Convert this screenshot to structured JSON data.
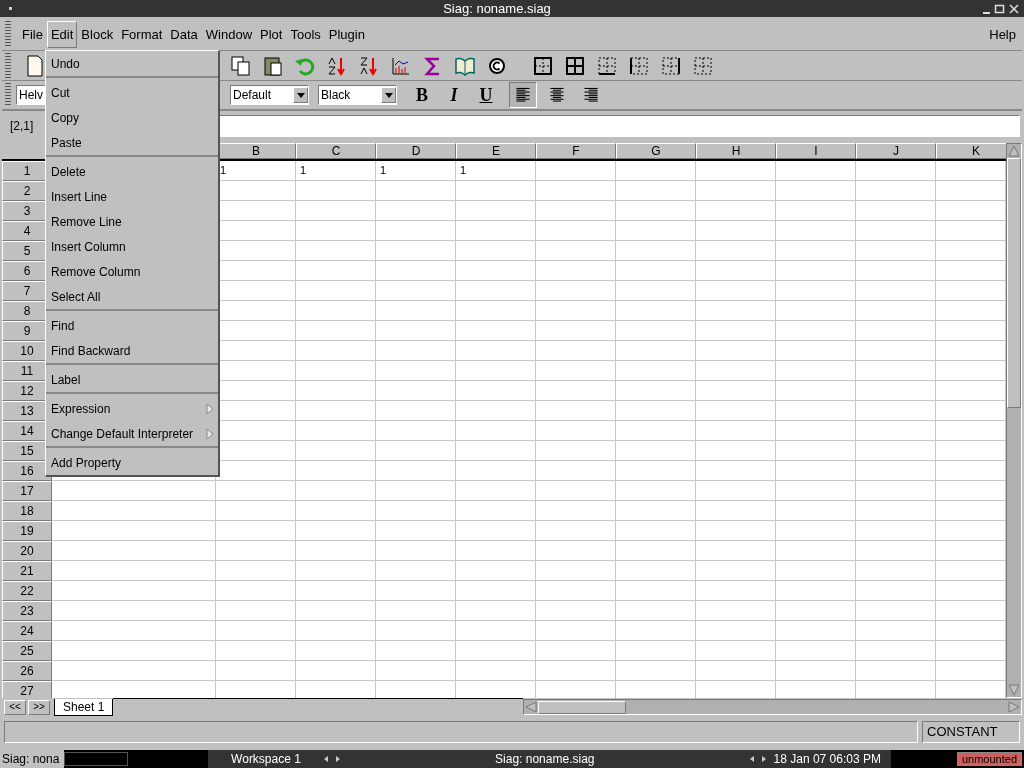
{
  "window": {
    "title": "Siag: noname.siag"
  },
  "menubar": {
    "items": [
      {
        "label": "File",
        "selected": false
      },
      {
        "label": "Edit",
        "selected": true
      },
      {
        "label": "Block",
        "selected": false
      },
      {
        "label": "Format",
        "selected": false
      },
      {
        "label": "Data",
        "selected": false
      },
      {
        "label": "Window",
        "selected": false
      },
      {
        "label": "Plot",
        "selected": false
      },
      {
        "label": "Tools",
        "selected": false
      },
      {
        "label": "Plugin",
        "selected": false
      }
    ],
    "help": "Help"
  },
  "format_bar": {
    "font": "Helv",
    "style": "Default",
    "text_color_name": "Black",
    "bold": "B",
    "italic": "I",
    "underline": "U",
    "alignments": [
      {
        "kind": "left",
        "selected": true
      },
      {
        "kind": "center",
        "selected": false
      },
      {
        "kind": "right",
        "selected": false
      }
    ]
  },
  "cell_ref": "[2,1]",
  "columns": [
    "B",
    "C",
    "D",
    "E",
    "F",
    "G",
    "H",
    "I",
    "J",
    "K"
  ],
  "rows": [
    {
      "label": "1",
      "values": [
        "1",
        "1",
        "1",
        "1"
      ]
    },
    {
      "label": "2"
    },
    {
      "label": "3"
    },
    {
      "label": "4"
    },
    {
      "label": "5"
    },
    {
      "label": "6"
    },
    {
      "label": "7"
    },
    {
      "label": "8"
    },
    {
      "label": "9"
    },
    {
      "label": "10"
    },
    {
      "label": "11"
    },
    {
      "label": "12"
    },
    {
      "label": "13"
    },
    {
      "label": "14"
    },
    {
      "label": "15"
    },
    {
      "label": "16"
    },
    {
      "label": "17"
    },
    {
      "label": "18"
    },
    {
      "label": "19"
    },
    {
      "label": "20"
    },
    {
      "label": "21"
    },
    {
      "label": "22"
    },
    {
      "label": "23"
    },
    {
      "label": "24"
    },
    {
      "label": "25"
    },
    {
      "label": "26"
    },
    {
      "label": "27"
    }
  ],
  "sheet_nav": [
    "<<",
    ">>"
  ],
  "sheet_tabs": [
    {
      "label": "Sheet 1",
      "selected": true
    }
  ],
  "status_bar": {
    "mode": "CONSTANT"
  },
  "edit_menu": {
    "groups": [
      [
        {
          "label": "Undo",
          "submenu": false
        }
      ],
      [
        {
          "label": "Cut",
          "submenu": false
        },
        {
          "label": "Copy",
          "submenu": false
        },
        {
          "label": "Paste",
          "submenu": false
        }
      ],
      [
        {
          "label": "Delete",
          "submenu": false
        },
        {
          "label": "Insert Line",
          "submenu": false
        },
        {
          "label": "Remove Line",
          "submenu": false
        },
        {
          "label": "Insert Column",
          "submenu": false
        },
        {
          "label": "Remove Column",
          "submenu": false
        },
        {
          "label": "Select All",
          "submenu": false
        }
      ],
      [
        {
          "label": "Find",
          "submenu": false
        },
        {
          "label": "Find Backward",
          "submenu": false
        }
      ],
      [
        {
          "label": "Label",
          "submenu": false
        }
      ],
      [
        {
          "label": "Expression",
          "submenu": true
        },
        {
          "label": "Change Default Interpreter",
          "submenu": true
        }
      ],
      [
        {
          "label": "Add Property",
          "submenu": false
        }
      ]
    ]
  },
  "taskbar": {
    "task": "Siag: nona",
    "workspace": "Workspace 1",
    "window": "Siag: noname.siag",
    "clock": "18 Jan 07 06:03 PM",
    "mount": "unmounted"
  }
}
